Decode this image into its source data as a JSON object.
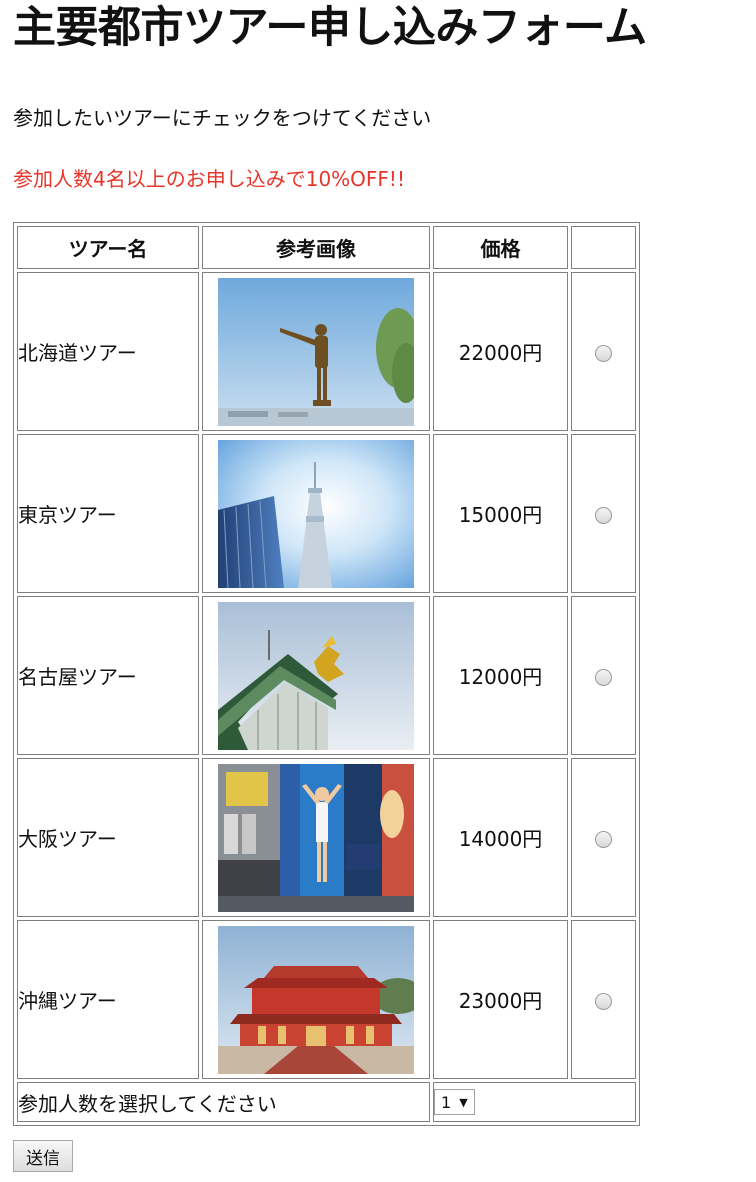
{
  "page": {
    "title": "主要都市ツアー申し込みフォーム",
    "intro": "参加したいツアーにチェックをつけてください",
    "promo": "参加人数4名以上のお申し込みで10%OFF!!"
  },
  "table": {
    "headers": [
      "ツアー名",
      "参考画像",
      "価格",
      ""
    ],
    "rows": [
      {
        "name": "北海道ツアー",
        "price": "22000円"
      },
      {
        "name": "東京ツアー",
        "price": "15000円"
      },
      {
        "name": "名古屋ツアー",
        "price": "12000円"
      },
      {
        "name": "大阪ツアー",
        "price": "14000円"
      },
      {
        "name": "沖縄ツアー",
        "price": "23000円"
      }
    ],
    "count_label": "参加人数を選択してください",
    "count_value": "1"
  },
  "submit_label": "送信",
  "colors": {
    "promo": "#e8352a",
    "border": "#808080"
  }
}
